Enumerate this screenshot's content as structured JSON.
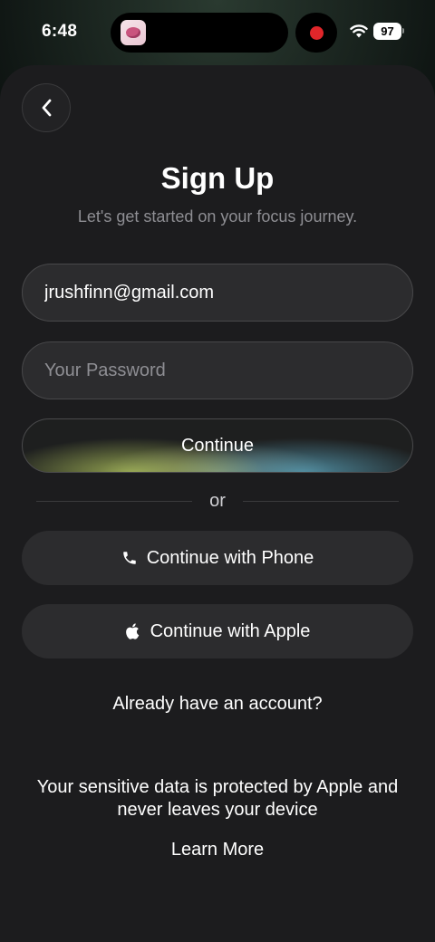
{
  "status_bar": {
    "time": "6:48",
    "battery": "97",
    "recording_color": "#e0262a"
  },
  "header": {
    "back_icon": "chevron-left-icon",
    "title": "Sign Up",
    "subtitle": "Let's get started on your focus journey."
  },
  "form": {
    "email_value": "jrushfinn@gmail.com",
    "password_placeholder": "Your Password",
    "continue_label": "Continue"
  },
  "divider_text": "or",
  "alt_auth": {
    "phone_label": "Continue with Phone",
    "phone_icon": "phone-icon",
    "apple_label": "Continue with Apple",
    "apple_icon": "apple-logo-icon"
  },
  "account_link": "Already have an account?",
  "privacy": {
    "note": "Your sensitive data is protected by Apple and never leaves your device",
    "learn_more": "Learn More"
  }
}
